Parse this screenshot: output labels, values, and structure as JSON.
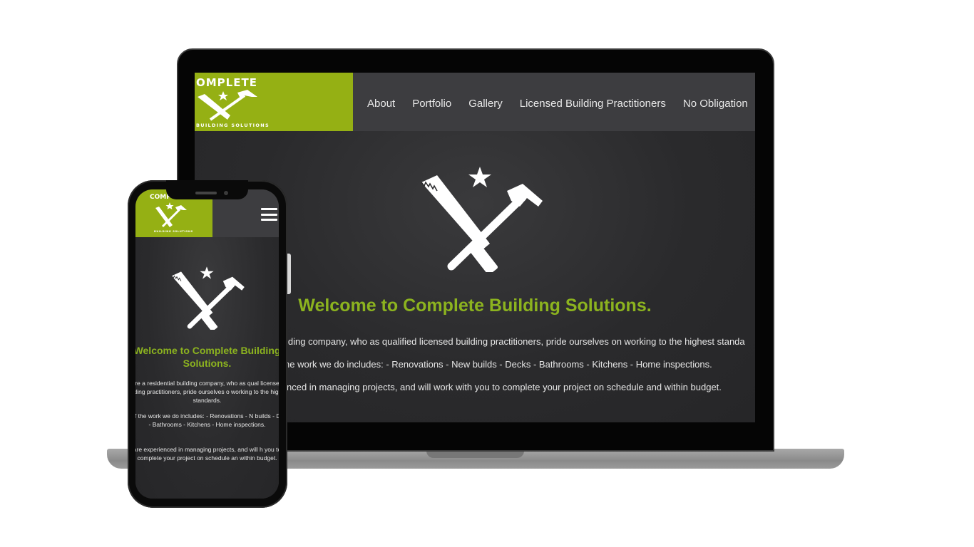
{
  "site": {
    "logo": {
      "text": "COMPLETE",
      "subtitle": "BUILDING SOLUTIONS"
    },
    "nav": [
      {
        "label": "About"
      },
      {
        "label": "Portfolio"
      },
      {
        "label": "Gallery"
      },
      {
        "label": "Licensed Building Practitioners"
      },
      {
        "label": "No Obligation"
      }
    ],
    "hero": {
      "title": "Welcome to Complete Building Solutions.",
      "paragraphs": [
        "We are a residential building company, who as qualified licensed building practitioners, pride ourselves on working to the highest standards.",
        "Some of the work we do includes: - Renovations - New builds - Decks - Bathrooms - Kitchens - Home inspections.",
        "We are experienced in managing projects, and will work with you to complete your project on schedule and within budget."
      ]
    }
  },
  "laptop_visible": {
    "logo_text": "OMPLETE",
    "logo_subtitle": "BUILDING SOLUTIONS",
    "p1": "lding company, who as qualified licensed building practitioners, pride ourselves on working to the highest standa",
    "p2": "ne work we do includes: - Renovations - New builds - Decks - Bathrooms - Kitchens - Home inspections.",
    "p3": "nced in managing projects, and will work with you to complete your project on schedule and within budget."
  },
  "phone_visible": {
    "logo_text": "COMP",
    "logo_subtitle": "BUILDING SOLUTIONS",
    "title": "Welcome to Complete Building Solutions.",
    "p1": "are a residential building company, who as qual licensed building practitioners, pride ourselves o working to the highest standards.",
    "p2": "me of the work we do includes: - Renovations - N builds - Decks - Bathrooms - Kitchens - Home inspections.",
    "p3": "are experienced in managing projects, and will h you to complete your project on schedule an within budget."
  },
  "colors": {
    "brand_green": "#95b014",
    "title_green": "#8cb31f",
    "header_bg": "#3d3d40",
    "page_bg": "#2d2d2f"
  },
  "icons": [
    "saw-hammer-logo-icon",
    "star-icon",
    "hamburger-menu-icon"
  ]
}
